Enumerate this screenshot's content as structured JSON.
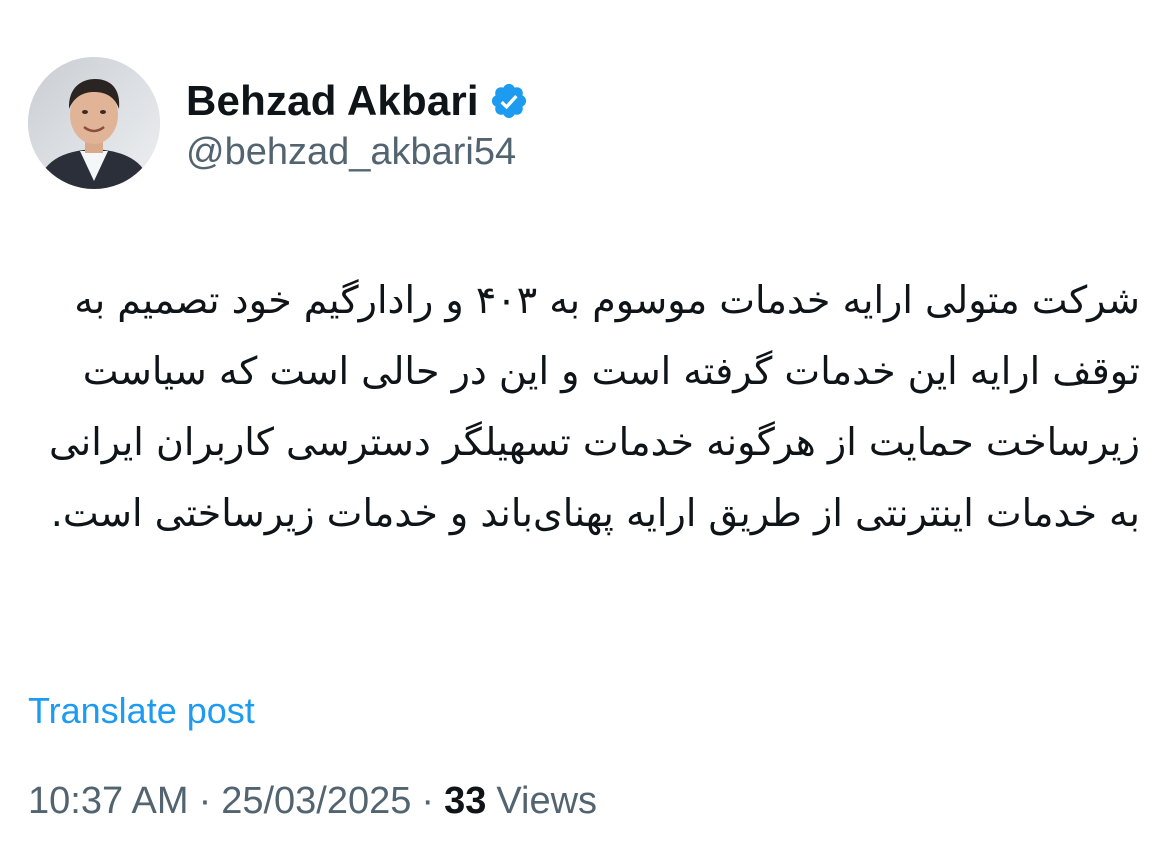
{
  "author": {
    "display_name": "Behzad Akbari",
    "handle": "@behzad_akbari54",
    "avatar_icon": "profile-photo",
    "verified_icon": "verified-badge-icon",
    "verified_color": "#1d9bf0"
  },
  "tweet": {
    "text": "شرکت متولی ارایه خدمات موسوم به ۴۰۳ و رادارگیم خود تصمیم به توقف ارایه این خدمات گرفته است و این در حالی است که سیاست زیرساخت حمایت از هرگونه خدمات تسهیلگر دسترسی کاربران ایرانی به خدمات اینترنتی از طریق ارایه پهنای‌باند و خدمات زیرساختی است."
  },
  "translate_label": "Translate post",
  "meta": {
    "time": "10:37 AM",
    "separator": "·",
    "date": "25/03/2025",
    "views_count": "33",
    "views_label": "Views"
  },
  "colors": {
    "link": "#1d9bf0",
    "secondary_text": "#536471",
    "primary_text": "#0f1419"
  }
}
